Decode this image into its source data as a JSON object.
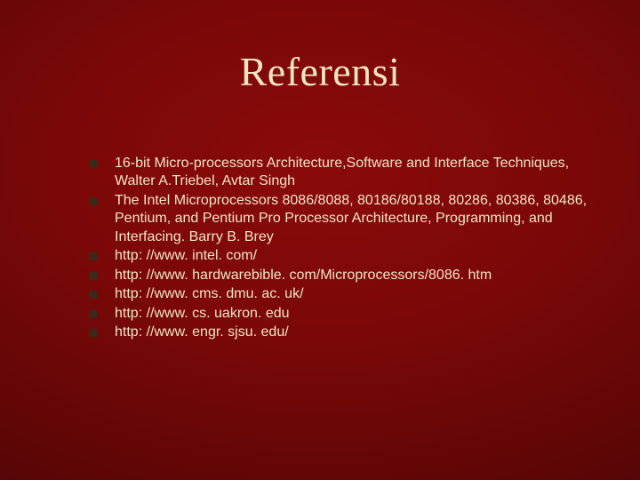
{
  "title": "Referensi",
  "items": [
    "16-bit Micro-processors Architecture,Software and Interface Techniques,  Walter A.Triebel, Avtar Singh",
    "The Intel Microprocessors 8086/8088, 80186/80188, 80286, 80386, 80486, Pentium, and Pentium Pro Processor Architecture, Programming, and Interfacing. Barry B. Brey",
    "http: //www. intel. com/",
    "http: //www. hardwarebible. com/Microprocessors/8086. htm",
    "http: //www. cms. dmu. ac. uk/",
    "http: //www. cs. uakron. edu",
    "http: //www. engr. sjsu. edu/"
  ]
}
